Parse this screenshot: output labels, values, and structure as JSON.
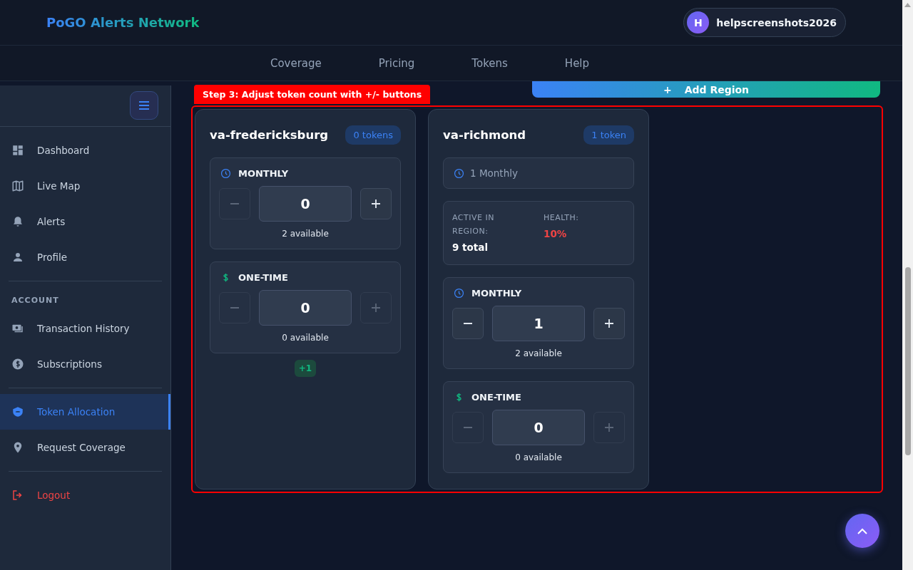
{
  "header": {
    "brand": "PoGO Alerts Network",
    "user": {
      "initial": "H",
      "name": "helpscreenshots2026"
    }
  },
  "nav": [
    {
      "label": "Coverage"
    },
    {
      "label": "Pricing"
    },
    {
      "label": "Tokens"
    },
    {
      "label": "Help"
    }
  ],
  "sidebar": {
    "groups": [
      {
        "items": [
          {
            "label": "Dashboard",
            "selected": false,
            "kind": "normal"
          },
          {
            "label": "Live Map",
            "selected": false,
            "kind": "normal"
          },
          {
            "label": "Alerts",
            "selected": false,
            "kind": "normal"
          },
          {
            "label": "Profile",
            "selected": false,
            "kind": "normal"
          }
        ]
      },
      {
        "heading": "ACCOUNT",
        "items": [
          {
            "label": "Transaction History",
            "selected": false,
            "kind": "normal"
          },
          {
            "label": "Subscriptions",
            "selected": false,
            "kind": "normal"
          }
        ]
      },
      {
        "items": [
          {
            "label": "Token Allocation",
            "selected": true,
            "kind": "normal"
          },
          {
            "label": "Request Coverage",
            "selected": false,
            "kind": "normal"
          }
        ]
      },
      {
        "items": [
          {
            "label": "Logout",
            "selected": false,
            "kind": "danger"
          }
        ]
      }
    ]
  },
  "add_region_button": {
    "icon": "+",
    "label": "Add Region"
  },
  "tutorial_step": "Step 3: Adjust token count with +/- buttons",
  "regions": [
    {
      "name": "va-fredericksburg",
      "badge": "0 tokens",
      "sections": [
        {
          "kind": "monthly_counter",
          "label": "MONTHLY",
          "value": "0",
          "minus_disabled": true,
          "plus_disabled": false,
          "available": "2 available"
        },
        {
          "kind": "one_time_counter",
          "label": "ONE-TIME",
          "value": "0",
          "minus_disabled": true,
          "plus_disabled": true,
          "available": "0 available"
        }
      ],
      "change": "+1"
    },
    {
      "name": "va-richmond",
      "badge": "1 token",
      "sections": [
        {
          "kind": "monthly_summary",
          "text": "1 Monthly"
        },
        {
          "kind": "stats",
          "active_label": "ACTIVE IN REGION:",
          "active_value": "9 total",
          "health_label": "HEALTH:",
          "health_value": "10%"
        },
        {
          "kind": "monthly_counter",
          "label": "MONTHLY",
          "value": "1",
          "minus_disabled": false,
          "plus_disabled": false,
          "available": "2 available"
        },
        {
          "kind": "one_time_counter",
          "label": "ONE-TIME",
          "value": "0",
          "minus_disabled": true,
          "plus_disabled": true,
          "available": "0 available"
        }
      ]
    }
  ]
}
